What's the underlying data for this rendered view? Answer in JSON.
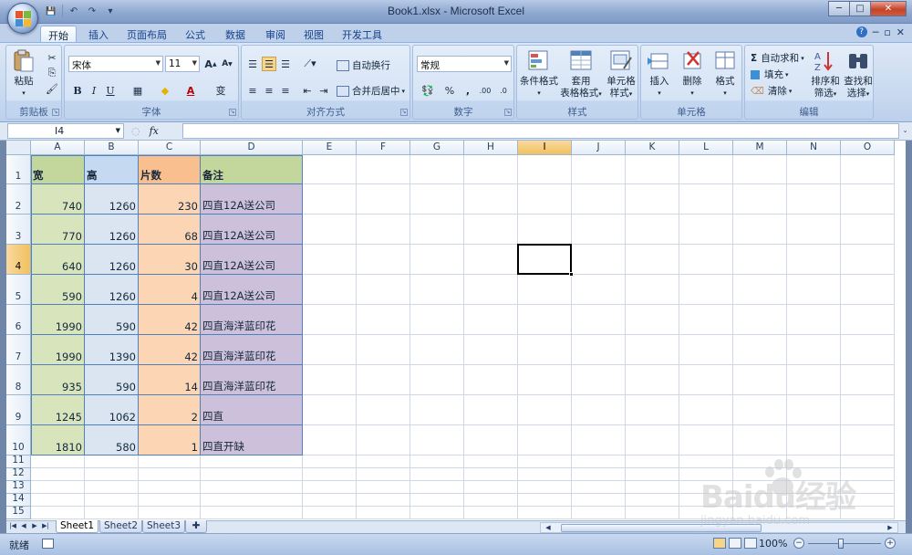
{
  "window": {
    "title": "Book1.xlsx - Microsoft Excel",
    "controls": {
      "minimize": "─",
      "maximize": "□",
      "close": "✕"
    }
  },
  "qat": {
    "save": "💾",
    "undo": "↶",
    "redo": "↷",
    "customize": "▾"
  },
  "ribbon_tabs": [
    "开始",
    "插入",
    "页面布局",
    "公式",
    "数据",
    "审阅",
    "视图",
    "开发工具"
  ],
  "help": {
    "help": "?",
    "min": "─",
    "restore": "▫",
    "close": "✕"
  },
  "groups": {
    "clipboard": {
      "label": "剪贴板",
      "paste": "粘贴"
    },
    "font": {
      "label": "字体",
      "font_name": "宋体",
      "font_size": "11",
      "grow": "A",
      "shrink": "A",
      "bold": "B",
      "italic": "I",
      "underline": "U",
      "pinyin": "变"
    },
    "alignment": {
      "label": "对齐方式",
      "wrap": "自动换行",
      "merge": "合并后居中"
    },
    "number": {
      "label": "数字",
      "format": "常规",
      "percent": "%",
      "comma": ",",
      "inc_decimal": ".00",
      "dec_decimal": ".0"
    },
    "styles": {
      "label": "样式",
      "cond_format": "条件格式",
      "table_format_1": "套用",
      "table_format_2": "表格格式",
      "cell_styles_1": "单元格",
      "cell_styles_2": "样式"
    },
    "cells": {
      "label": "单元格",
      "insert": "插入",
      "delete": "删除",
      "format": "格式"
    },
    "editing": {
      "label": "编辑",
      "autosum": "自动求和",
      "fill": "填充",
      "clear": "清除",
      "sort_1": "排序和",
      "sort_2": "筛选",
      "find_1": "查找和",
      "find_2": "选择"
    }
  },
  "formula_bar": {
    "name_box": "I4",
    "fx": "fx",
    "formula": ""
  },
  "columns": [
    "A",
    "B",
    "C",
    "D",
    "E",
    "F",
    "G",
    "H",
    "I",
    "J",
    "K",
    "L",
    "M",
    "N",
    "O"
  ],
  "rows": [
    "1",
    "2",
    "3",
    "4",
    "5",
    "6",
    "7",
    "8",
    "9",
    "10",
    "11",
    "12",
    "13",
    "14",
    "15"
  ],
  "table": {
    "headers": [
      "宽",
      "高",
      "片数",
      "备注"
    ],
    "rows": [
      [
        "740",
        "1260",
        "230",
        "四直12A送公司"
      ],
      [
        "770",
        "1260",
        "68",
        "四直12A送公司"
      ],
      [
        "640",
        "1260",
        "30",
        "四直12A送公司"
      ],
      [
        "590",
        "1260",
        "4",
        "四直12A送公司"
      ],
      [
        "1990",
        "590",
        "42",
        "四直海洋蓝印花"
      ],
      [
        "1990",
        "1390",
        "42",
        "四直海洋蓝印花"
      ],
      [
        "935",
        "590",
        "14",
        "四直海洋蓝印花"
      ],
      [
        "1245",
        "1062",
        "2",
        "四直"
      ],
      [
        "1810",
        "580",
        "1",
        "四直开缺"
      ]
    ]
  },
  "selected_cell": "I4",
  "sheets": [
    "Sheet1",
    "Sheet2",
    "Sheet3"
  ],
  "active_sheet": "Sheet1",
  "status": {
    "ready": "就绪",
    "zoom": "100%"
  },
  "watermark": {
    "brand": "Baidu经验",
    "url": "jingyan.baidu.com"
  },
  "colors": {
    "colA": "#d7e4bc",
    "colB": "#dbe5f1",
    "colC": "#fcd5b4",
    "colD": "#ccc0da",
    "accent": "#4f81bd"
  }
}
